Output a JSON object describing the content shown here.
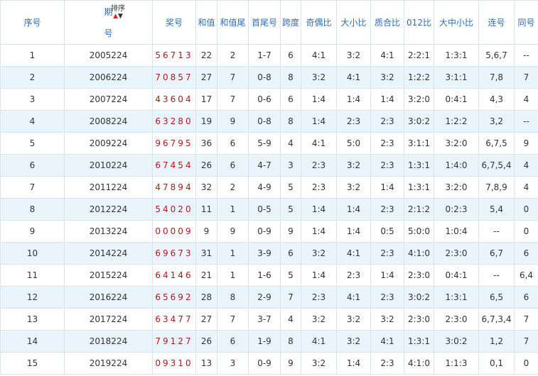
{
  "headers": {
    "index": "序号",
    "period_top": "期",
    "period_bottom": "号",
    "sort_label": "排序",
    "sort_up_icon": "▲",
    "sort_down_icon": "▼",
    "award": "奖号",
    "sum": "和值",
    "sum_tail": "和值尾",
    "first_last": "首尾号",
    "span": "跨度",
    "odd_even": "奇偶比",
    "big_small": "大小比",
    "prime_composite": "质合比",
    "mod012": "012比",
    "big_mid_small": "大中小比",
    "consecutive": "连号",
    "same": "同号"
  },
  "colors": {
    "header_text": "#2f6db3",
    "award_text": "#b0191c",
    "stripe": "#e9f4fd",
    "border": "#d9e4ef",
    "sort_up": "#d8242a"
  },
  "rows": [
    {
      "index": "1",
      "period": "2005224",
      "award": "56713",
      "sum": "22",
      "sum_tail": "2",
      "first_last": "1-7",
      "span": "6",
      "odd_even": "4:1",
      "big_small": "3:2",
      "prime_composite": "4:1",
      "mod012": "2:2:1",
      "big_mid_small": "1:3:1",
      "consecutive": "5,6,7",
      "same": "--"
    },
    {
      "index": "2",
      "period": "2006224",
      "award": "70857",
      "sum": "27",
      "sum_tail": "7",
      "first_last": "0-8",
      "span": "8",
      "odd_even": "3:2",
      "big_small": "4:1",
      "prime_composite": "3:2",
      "mod012": "1:2:2",
      "big_mid_small": "3:1:1",
      "consecutive": "7,8",
      "same": "7"
    },
    {
      "index": "3",
      "period": "2007224",
      "award": "43604",
      "sum": "17",
      "sum_tail": "7",
      "first_last": "0-6",
      "span": "6",
      "odd_even": "1:4",
      "big_small": "1:4",
      "prime_composite": "1:4",
      "mod012": "3:2:0",
      "big_mid_small": "0:4:1",
      "consecutive": "4,3",
      "same": "4"
    },
    {
      "index": "4",
      "period": "2008224",
      "award": "63280",
      "sum": "19",
      "sum_tail": "9",
      "first_last": "0-8",
      "span": "8",
      "odd_even": "1:4",
      "big_small": "2:3",
      "prime_composite": "2:3",
      "mod012": "3:0:2",
      "big_mid_small": "1:2:2",
      "consecutive": "3,2",
      "same": "--"
    },
    {
      "index": "5",
      "period": "2009224",
      "award": "96795",
      "sum": "36",
      "sum_tail": "6",
      "first_last": "5-9",
      "span": "4",
      "odd_even": "4:1",
      "big_small": "5:0",
      "prime_composite": "2:3",
      "mod012": "3:1:1",
      "big_mid_small": "3:2:0",
      "consecutive": "6,7,5",
      "same": "9"
    },
    {
      "index": "6",
      "period": "2010224",
      "award": "67454",
      "sum": "26",
      "sum_tail": "6",
      "first_last": "4-7",
      "span": "3",
      "odd_even": "2:3",
      "big_small": "3:2",
      "prime_composite": "2:3",
      "mod012": "1:3:1",
      "big_mid_small": "1:4:0",
      "consecutive": "6,7,5,4",
      "same": "4"
    },
    {
      "index": "7",
      "period": "2011224",
      "award": "47894",
      "sum": "32",
      "sum_tail": "2",
      "first_last": "4-9",
      "span": "5",
      "odd_even": "2:3",
      "big_small": "3:2",
      "prime_composite": "1:4",
      "mod012": "1:3:1",
      "big_mid_small": "3:2:0",
      "consecutive": "7,8,9",
      "same": "4"
    },
    {
      "index": "8",
      "period": "2012224",
      "award": "54020",
      "sum": "11",
      "sum_tail": "1",
      "first_last": "0-5",
      "span": "5",
      "odd_even": "1:4",
      "big_small": "1:4",
      "prime_composite": "2:3",
      "mod012": "2:1:2",
      "big_mid_small": "0:2:3",
      "consecutive": "5,4",
      "same": "0"
    },
    {
      "index": "9",
      "period": "2013224",
      "award": "00009",
      "sum": "9",
      "sum_tail": "9",
      "first_last": "0-9",
      "span": "9",
      "odd_even": "1:4",
      "big_small": "1:4",
      "prime_composite": "0:5",
      "mod012": "5:0:0",
      "big_mid_small": "1:0:4",
      "consecutive": "--",
      "same": "0"
    },
    {
      "index": "10",
      "period": "2014224",
      "award": "69673",
      "sum": "31",
      "sum_tail": "1",
      "first_last": "3-9",
      "span": "6",
      "odd_even": "3:2",
      "big_small": "4:1",
      "prime_composite": "2:3",
      "mod012": "4:1:0",
      "big_mid_small": "2:3:0",
      "consecutive": "6,7",
      "same": "6"
    },
    {
      "index": "11",
      "period": "2015224",
      "award": "64146",
      "sum": "21",
      "sum_tail": "1",
      "first_last": "1-6",
      "span": "5",
      "odd_even": "1:4",
      "big_small": "2:3",
      "prime_composite": "1:4",
      "mod012": "2:3:0",
      "big_mid_small": "0:4:1",
      "consecutive": "--",
      "same": "6,4"
    },
    {
      "index": "12",
      "period": "2016224",
      "award": "65692",
      "sum": "28",
      "sum_tail": "8",
      "first_last": "2-9",
      "span": "7",
      "odd_even": "2:3",
      "big_small": "4:1",
      "prime_composite": "2:3",
      "mod012": "3:0:2",
      "big_mid_small": "1:3:1",
      "consecutive": "6,5",
      "same": "6"
    },
    {
      "index": "13",
      "period": "2017224",
      "award": "63477",
      "sum": "27",
      "sum_tail": "7",
      "first_last": "3-7",
      "span": "4",
      "odd_even": "3:2",
      "big_small": "3:2",
      "prime_composite": "3:2",
      "mod012": "2:3:0",
      "big_mid_small": "2:3:0",
      "consecutive": "6,7,3,4",
      "same": "7"
    },
    {
      "index": "14",
      "period": "2018224",
      "award": "79127",
      "sum": "26",
      "sum_tail": "6",
      "first_last": "1-9",
      "span": "8",
      "odd_even": "4:1",
      "big_small": "3:2",
      "prime_composite": "4:1",
      "mod012": "1:3:1",
      "big_mid_small": "3:0:2",
      "consecutive": "1,2",
      "same": "7"
    },
    {
      "index": "15",
      "period": "2019224",
      "award": "09310",
      "sum": "13",
      "sum_tail": "3",
      "first_last": "0-9",
      "span": "9",
      "odd_even": "3:2",
      "big_small": "1:4",
      "prime_composite": "2:3",
      "mod012": "4:1:0",
      "big_mid_small": "1:1:3",
      "consecutive": "0,1",
      "same": "0"
    }
  ]
}
